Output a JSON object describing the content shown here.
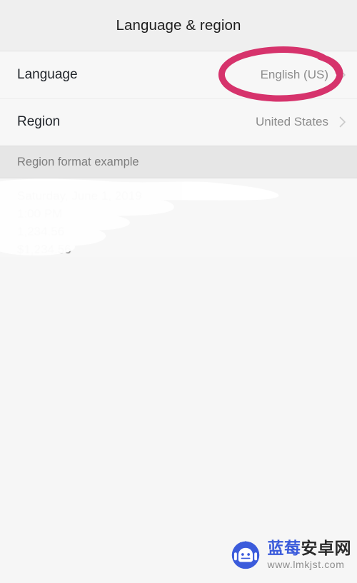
{
  "header": {
    "title": "Language & region"
  },
  "settings": {
    "rows": [
      {
        "label": "Language",
        "value": "English (US)",
        "chevron": "chevron-right-icon"
      },
      {
        "label": "Region",
        "value": "United States",
        "chevron": "chevron-right-icon"
      }
    ]
  },
  "section": {
    "title": "Region format example",
    "example_lines": [
      "Saturday, June 1, 2019",
      "1:00 PM",
      "1,234.56",
      "$1,234.56"
    ],
    "redacted": true
  },
  "annotation": {
    "type": "hand-drawn-ellipse",
    "target": "English (US)",
    "color": "#d6336c"
  },
  "watermark": {
    "logo": "android-mascot-icon",
    "brand_primary": "蓝莓",
    "brand_secondary": "安卓网",
    "url": "www.lmkjst.com",
    "brand_primary_color": "#3b5bdb",
    "brand_secondary_color": "#2b2b2b"
  }
}
